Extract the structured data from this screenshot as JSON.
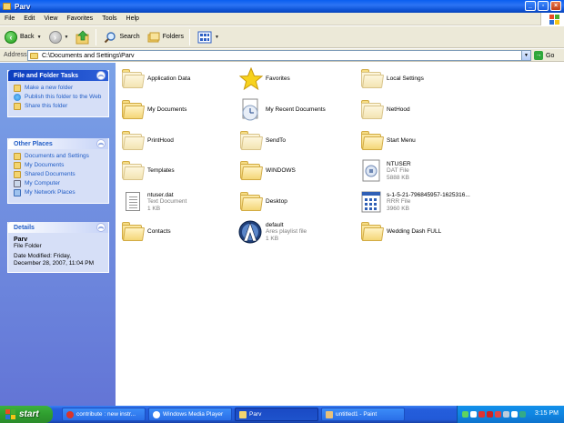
{
  "window": {
    "title": "Parv"
  },
  "menu": [
    "File",
    "Edit",
    "View",
    "Favorites",
    "Tools",
    "Help"
  ],
  "toolbar": {
    "back": "Back",
    "search": "Search",
    "folders": "Folders"
  },
  "address": {
    "label": "Address",
    "path": "C:\\Documents and Settings\\Parv",
    "go": "Go"
  },
  "tasks": {
    "file_folder": {
      "title": "File and Folder Tasks",
      "items": [
        "Make a new folder",
        "Publish this folder to the Web",
        "Share this folder"
      ]
    },
    "other_places": {
      "title": "Other Places",
      "items": [
        "Documents and Settings",
        "My Documents",
        "Shared Documents",
        "My Computer",
        "My Network Places"
      ]
    },
    "details": {
      "title": "Details",
      "name": "Parv",
      "type": "File Folder",
      "modified_line1": "Date Modified: Friday,",
      "modified_line2": "December 28, 2007, 11:04 PM"
    }
  },
  "files": [
    {
      "name": "Application Data",
      "kind": "folder-light"
    },
    {
      "name": "Favorites",
      "kind": "star"
    },
    {
      "name": "Local Settings",
      "kind": "folder-light"
    },
    {
      "name": "My Documents",
      "kind": "folder"
    },
    {
      "name": "My Recent Documents",
      "kind": "recent"
    },
    {
      "name": "NetHood",
      "kind": "folder-light"
    },
    {
      "name": "PrintHood",
      "kind": "folder-light"
    },
    {
      "name": "SendTo",
      "kind": "folder-light"
    },
    {
      "name": "Start Menu",
      "kind": "folder"
    },
    {
      "name": "Templates",
      "kind": "folder-light"
    },
    {
      "name": "WINDOWS",
      "kind": "folder"
    },
    {
      "name": "NTUSER",
      "kind": "dat",
      "type": "DAT File",
      "size": "5888 KB"
    },
    {
      "name": "ntuser.dat",
      "kind": "txt",
      "type": "Text Document",
      "size": "1 KB"
    },
    {
      "name": "Desktop",
      "kind": "folder"
    },
    {
      "name": "s-1-5-21-796845957-1625316...",
      "kind": "rrr",
      "type": "RRR File",
      "size": "3960 KB"
    },
    {
      "name": "Contacts",
      "kind": "folder"
    },
    {
      "name": "default",
      "kind": "ares",
      "type": "Ares playlist file",
      "size": "1 KB"
    },
    {
      "name": "Wedding Dash FULL",
      "kind": "folder"
    }
  ],
  "taskbar": {
    "start": "start",
    "buttons": [
      "contribute : new instr...",
      "Windows Media Player",
      "Parv",
      "untitled1 - Paint"
    ],
    "clock": "3:15 PM"
  }
}
